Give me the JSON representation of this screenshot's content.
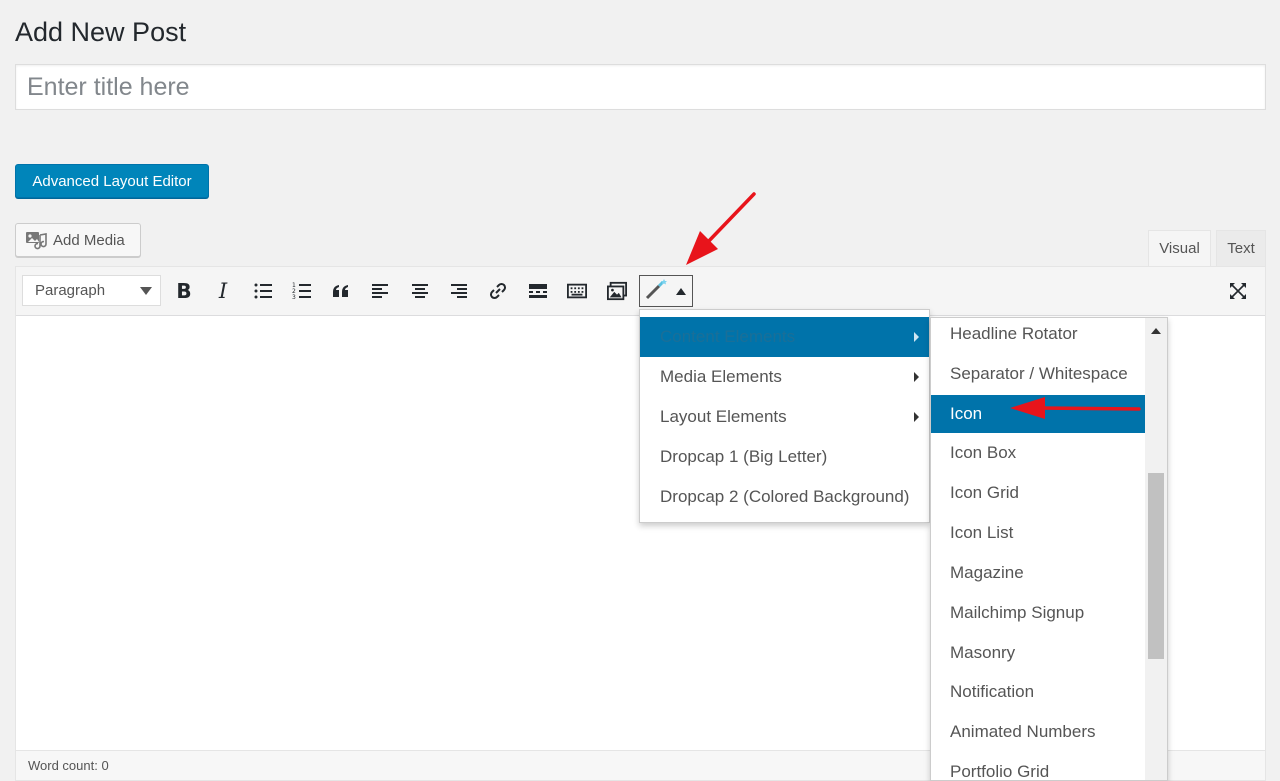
{
  "page": {
    "title": "Add New Post"
  },
  "title_field": {
    "placeholder": "Enter title here",
    "value": ""
  },
  "buttons": {
    "advanced_layout_editor": "Advanced Layout Editor",
    "add_media": "Add Media"
  },
  "tabs": {
    "visual": "Visual",
    "text": "Text"
  },
  "toolbar": {
    "format_select": "Paragraph",
    "icons": [
      "bold-icon",
      "italic-icon",
      "bulleted-list-icon",
      "numbered-list-icon",
      "blockquote-icon",
      "align-left-icon",
      "align-center-icon",
      "align-right-icon",
      "link-icon",
      "read-more-icon",
      "toolbar-toggle-icon",
      "insert-gallery-icon",
      "shortcode-wand-icon",
      "fullscreen-icon"
    ],
    "bold": "B",
    "italic": "I"
  },
  "menu": {
    "items": [
      {
        "label": "Content Elements",
        "has_submenu": true,
        "active": true
      },
      {
        "label": "Media Elements",
        "has_submenu": true
      },
      {
        "label": "Layout Elements",
        "has_submenu": true
      },
      {
        "label": "Dropcap 1 (Big Letter)",
        "has_submenu": false
      },
      {
        "label": "Dropcap 2 (Colored Background)",
        "has_submenu": false
      }
    ]
  },
  "submenu": {
    "items": [
      {
        "label": "Headline Rotator"
      },
      {
        "label": "Separator / Whitespace"
      },
      {
        "label": "Icon",
        "active": true
      },
      {
        "label": "Icon Box"
      },
      {
        "label": "Icon Grid"
      },
      {
        "label": "Icon List"
      },
      {
        "label": "Magazine"
      },
      {
        "label": "Mailchimp Signup"
      },
      {
        "label": "Masonry"
      },
      {
        "label": "Notification"
      },
      {
        "label": "Animated Numbers"
      },
      {
        "label": "Portfolio Grid"
      }
    ]
  },
  "status": {
    "word_count": "Word count: 0"
  },
  "colors": {
    "primary": "#0085ba",
    "menu_active": "#0073aa",
    "annotation": "#e8141b"
  }
}
